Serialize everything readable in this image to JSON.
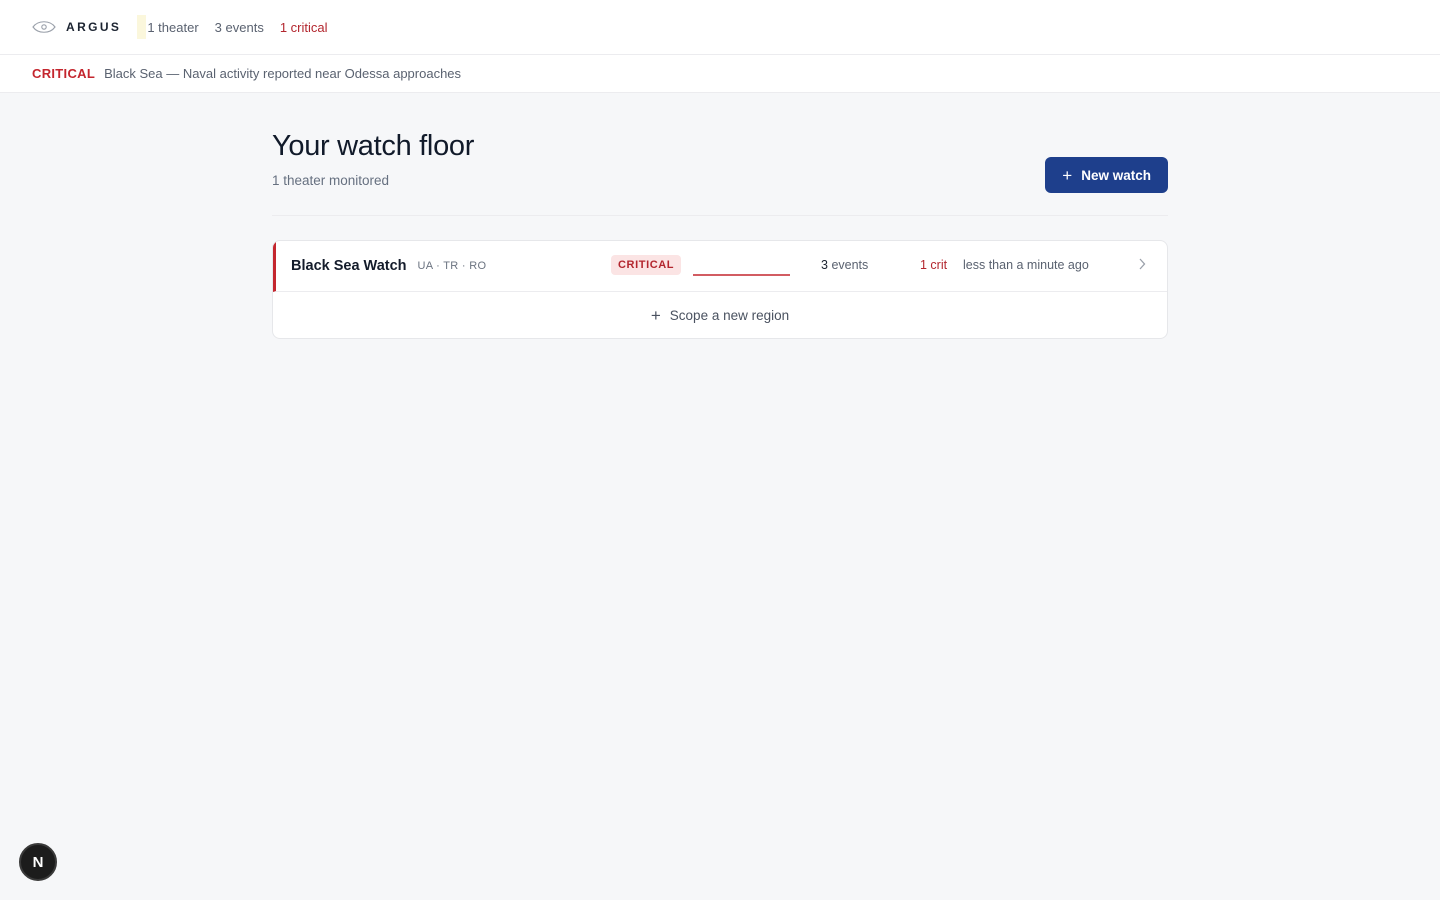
{
  "app": {
    "name": "ARGUS"
  },
  "topbar": {
    "stats": {
      "theaters": "1 theater",
      "events": "3 events",
      "critical": "1 critical"
    }
  },
  "alert": {
    "severity": "CRITICAL",
    "message": "Black Sea — Naval activity reported near Odessa approaches"
  },
  "page": {
    "title": "Your watch floor",
    "subtitle": "1 theater monitored",
    "new_watch_label": "New watch"
  },
  "watches": [
    {
      "name": "Black Sea Watch",
      "codes": "UA · TR · RO",
      "severity": "CRITICAL",
      "events_count": "3",
      "events_label": "events",
      "crit": "1 crit",
      "updated": "less than a minute ago"
    }
  ],
  "scope": {
    "label": "Scope a new region"
  },
  "fab": {
    "letter": "N"
  },
  "colors": {
    "accent": "#1e3f8c",
    "critical": "#c4262e",
    "background": "#f6f7f9"
  },
  "icons": [
    "eye-icon",
    "plus-icon",
    "chevron-right-icon"
  ]
}
